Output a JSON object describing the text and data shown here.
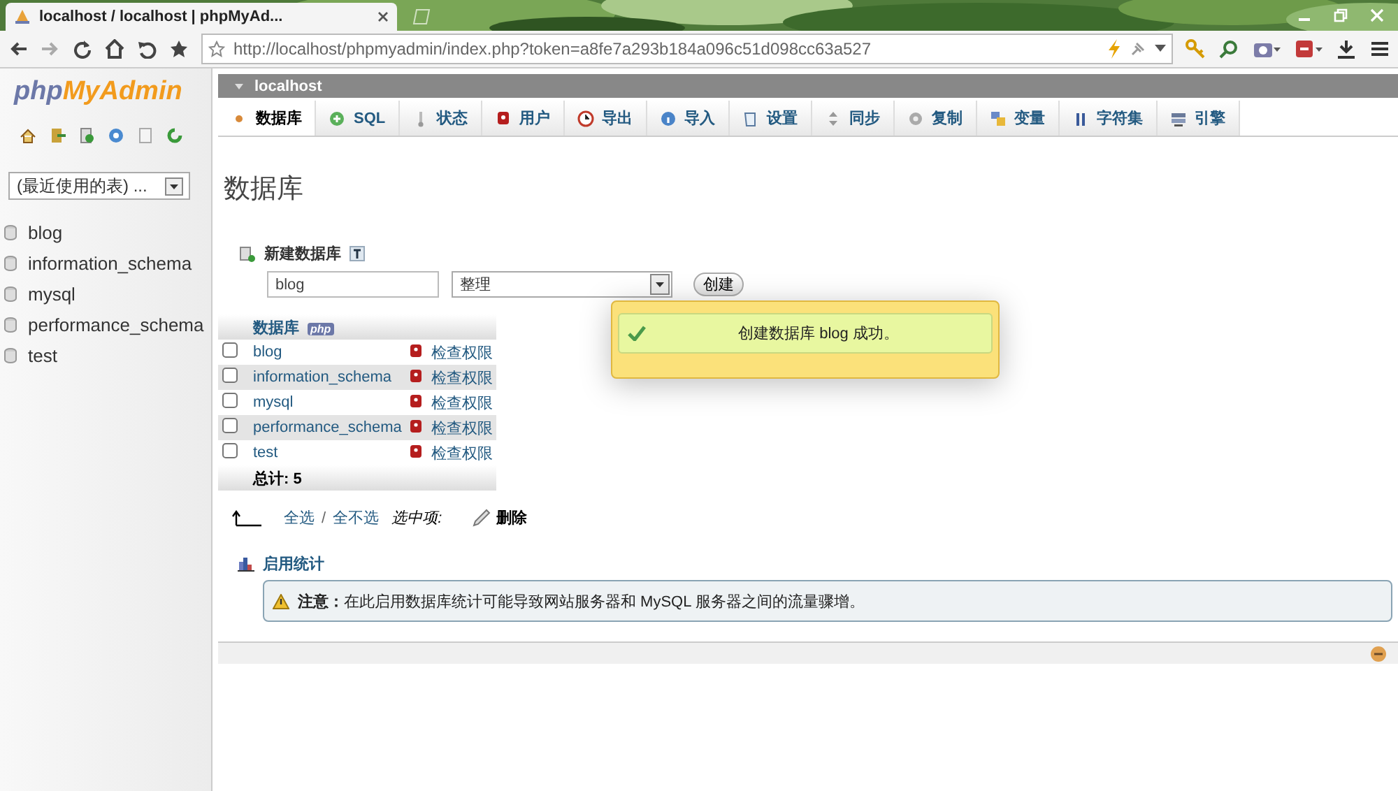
{
  "browser": {
    "tab": {
      "title": "localhost / localhost | phpMyAd...",
      "selected": true
    },
    "address": "http://localhost/phpmyadmin/index.php?token=a8fe7a293b184a096c51d098cc63a527"
  },
  "sidebar": {
    "logo": [
      "php",
      "MyAdmin"
    ],
    "recent_tables": "(最近使用的表) ...",
    "databases": [
      {
        "name": "blog"
      },
      {
        "name": "information_schema"
      },
      {
        "name": "mysql"
      },
      {
        "name": "performance_schema"
      },
      {
        "name": "test"
      }
    ]
  },
  "breadcrumb": "localhost",
  "tabs": [
    {
      "label": "数据库",
      "selected": true
    },
    {
      "label": "SQL",
      "selected": false
    },
    {
      "label": "状态",
      "selected": false
    },
    {
      "label": "用户",
      "selected": false
    },
    {
      "label": "导出",
      "selected": false
    },
    {
      "label": "导入",
      "selected": false
    },
    {
      "label": "设置",
      "selected": false
    },
    {
      "label": "同步",
      "selected": false
    },
    {
      "label": "复制",
      "selected": false
    },
    {
      "label": "变量",
      "selected": false
    },
    {
      "label": "字符集",
      "selected": false
    },
    {
      "label": "引擎",
      "selected": false
    }
  ],
  "page_title": "数据库",
  "create": {
    "heading": "新建数据库",
    "name_value": "blog",
    "collation": "整理",
    "button": "创建"
  },
  "table": {
    "column": "数据库",
    "badge": "php",
    "rows": [
      {
        "name": "blog",
        "action": "检查权限",
        "checked": false
      },
      {
        "name": "information_schema",
        "action": "检查权限",
        "checked": false
      },
      {
        "name": "mysql",
        "action": "检查权限",
        "checked": false
      },
      {
        "name": "performance_schema",
        "action": "检查权限",
        "checked": false
      },
      {
        "name": "test",
        "action": "检查权限",
        "checked": false
      }
    ],
    "total": "总计: 5"
  },
  "bulk": {
    "select_all": "全选",
    "separator": "/",
    "unselect_all": "全不选",
    "with_selected": "选中项:",
    "delete": "删除"
  },
  "stats": {
    "heading": "启用统计",
    "notice": "**注意：**在此启用数据库统计可能导致网站服务器和 MySQL 服务器之间的流量骤增。"
  },
  "toast": {
    "message": "创建数据库 blog 成功。"
  }
}
